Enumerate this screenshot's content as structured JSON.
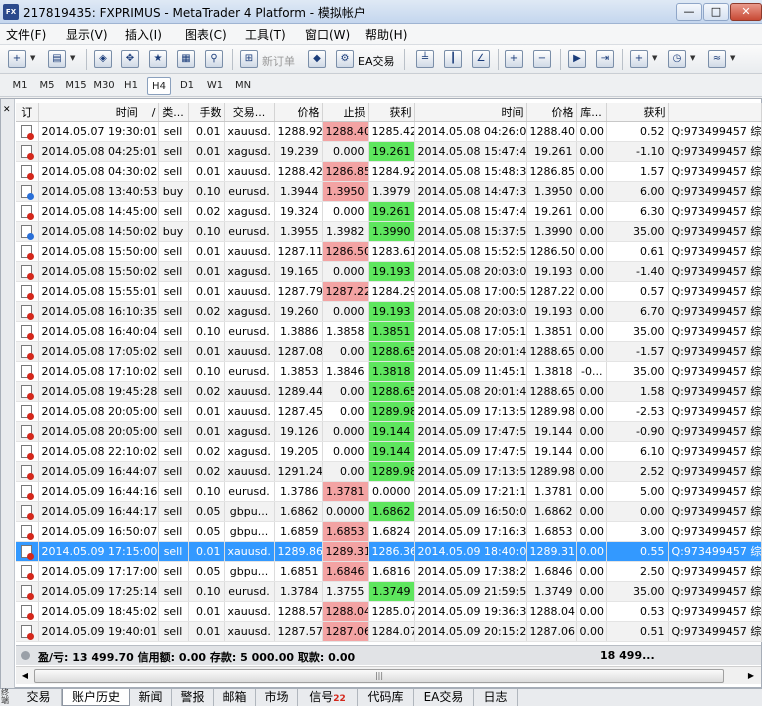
{
  "window": {
    "title": "217819435: FXPRIMUS - MetaTrader 4 Platform - 模拟帐户",
    "icon_label": "FX"
  },
  "menu": [
    "文件(F)",
    "显示(V)",
    "插入(I)",
    "图表(C)",
    "工具(T)",
    "窗口(W)",
    "帮助(H)"
  ],
  "toolbar": {
    "new_order": "新订单",
    "expert_advisors": "EA交易"
  },
  "timeframes": [
    "M1",
    "M5",
    "M15",
    "M30",
    "H1",
    "H4",
    "D1",
    "W1",
    "MN"
  ],
  "active_timeframe": "H4",
  "columns": [
    "订",
    "时间",
    "类...",
    "手数",
    "交易...",
    "价格",
    "止损",
    "获利",
    "时间",
    "价格",
    "库...",
    "获利",
    ""
  ],
  "sort_marker": "/",
  "colors": {
    "sl_hit": "#f3a3a3",
    "tp_hit": "#5ee65e",
    "selected": "#3399ff"
  },
  "rows": [
    {
      "open_time": "2014.05.07 19:30:01",
      "type": "sell",
      "lots": "0.01",
      "symbol": "xauusd.",
      "price": "1288.92",
      "sl": "1288.40",
      "tp": "1285.42",
      "close_time": "2014.05.08 04:26:08",
      "close_price": "1288.40",
      "swap": "0.00",
      "profit": "0.52",
      "comment": "Q:973499457 综合 ",
      "hit": "sl"
    },
    {
      "open_time": "2014.05.08 04:25:01",
      "type": "sell",
      "lots": "0.01",
      "symbol": "xagusd.",
      "price": "19.239",
      "sl": "0.000",
      "tp": "19.261",
      "close_time": "2014.05.08 15:47:40",
      "close_price": "19.261",
      "swap": "0.00",
      "profit": "-1.10",
      "comment": "Q:973499457 综合 ",
      "hit": "tp"
    },
    {
      "open_time": "2014.05.08 04:30:02",
      "type": "sell",
      "lots": "0.01",
      "symbol": "xauusd.",
      "price": "1288.42",
      "sl": "1286.85",
      "tp": "1284.92",
      "close_time": "2014.05.08 15:48:33",
      "close_price": "1286.85",
      "swap": "0.00",
      "profit": "1.57",
      "comment": "Q:973499457 综合 ",
      "hit": "sl"
    },
    {
      "open_time": "2014.05.08 13:40:53",
      "type": "buy",
      "lots": "0.10",
      "symbol": "eurusd.",
      "price": "1.3944",
      "sl": "1.3950",
      "tp": "1.3979",
      "close_time": "2014.05.08 14:47:38",
      "close_price": "1.3950",
      "swap": "0.00",
      "profit": "6.00",
      "comment": "Q:973499457 综合 ",
      "hit": "sl"
    },
    {
      "open_time": "2014.05.08 14:45:00",
      "type": "sell",
      "lots": "0.02",
      "symbol": "xagusd.",
      "price": "19.324",
      "sl": "0.000",
      "tp": "19.261",
      "close_time": "2014.05.08 15:47:40",
      "close_price": "19.261",
      "swap": "0.00",
      "profit": "6.30",
      "comment": "Q:973499457 综合 ",
      "hit": "tp"
    },
    {
      "open_time": "2014.05.08 14:50:02",
      "type": "buy",
      "lots": "0.10",
      "symbol": "eurusd.",
      "price": "1.3955",
      "sl": "1.3982",
      "tp": "1.3990",
      "close_time": "2014.05.08 15:37:54",
      "close_price": "1.3990",
      "swap": "0.00",
      "profit": "35.00",
      "comment": "Q:973499457 综合 ",
      "hit": "tp"
    },
    {
      "open_time": "2014.05.08 15:50:00",
      "type": "sell",
      "lots": "0.01",
      "symbol": "xauusd.",
      "price": "1287.11",
      "sl": "1286.50",
      "tp": "1283.61",
      "close_time": "2014.05.08 15:52:53",
      "close_price": "1286.50",
      "swap": "0.00",
      "profit": "0.61",
      "comment": "Q:973499457 综合 ",
      "hit": "sl"
    },
    {
      "open_time": "2014.05.08 15:50:02",
      "type": "sell",
      "lots": "0.01",
      "symbol": "xagusd.",
      "price": "19.165",
      "sl": "0.000",
      "tp": "19.193",
      "close_time": "2014.05.08 20:03:07",
      "close_price": "19.193",
      "swap": "0.00",
      "profit": "-1.40",
      "comment": "Q:973499457 综合 ",
      "hit": "tp"
    },
    {
      "open_time": "2014.05.08 15:55:01",
      "type": "sell",
      "lots": "0.01",
      "symbol": "xauusd.",
      "price": "1287.79",
      "sl": "1287.22",
      "tp": "1284.29",
      "close_time": "2014.05.08 17:00:57",
      "close_price": "1287.22",
      "swap": "0.00",
      "profit": "0.57",
      "comment": "Q:973499457 综合 ",
      "hit": "sl"
    },
    {
      "open_time": "2014.05.08 16:10:35",
      "type": "sell",
      "lots": "0.02",
      "symbol": "xagusd.",
      "price": "19.260",
      "sl": "0.000",
      "tp": "19.193",
      "close_time": "2014.05.08 20:03:07",
      "close_price": "19.193",
      "swap": "0.00",
      "profit": "6.70",
      "comment": "Q:973499457 综合 ",
      "hit": "tp"
    },
    {
      "open_time": "2014.05.08 16:40:04",
      "type": "sell",
      "lots": "0.10",
      "symbol": "eurusd.",
      "price": "1.3886",
      "sl": "1.3858",
      "tp": "1.3851",
      "close_time": "2014.05.08 17:05:15",
      "close_price": "1.3851",
      "swap": "0.00",
      "profit": "35.00",
      "comment": "Q:973499457 综合 ",
      "hit": "tp"
    },
    {
      "open_time": "2014.05.08 17:05:02",
      "type": "sell",
      "lots": "0.01",
      "symbol": "xauusd.",
      "price": "1287.08",
      "sl": "0.00",
      "tp": "1288.65",
      "close_time": "2014.05.08 20:01:44",
      "close_price": "1288.65",
      "swap": "0.00",
      "profit": "-1.57",
      "comment": "Q:973499457 综合 ",
      "hit": "tp"
    },
    {
      "open_time": "2014.05.08 17:10:02",
      "type": "sell",
      "lots": "0.10",
      "symbol": "eurusd.",
      "price": "1.3853",
      "sl": "1.3846",
      "tp": "1.3818",
      "close_time": "2014.05.09 11:45:12",
      "close_price": "1.3818",
      "swap": "-0...",
      "profit": "35.00",
      "comment": "Q:973499457 综合 ",
      "hit": "tp"
    },
    {
      "open_time": "2014.05.08 19:45:28",
      "type": "sell",
      "lots": "0.02",
      "symbol": "xauusd.",
      "price": "1289.44",
      "sl": "0.00",
      "tp": "1288.65",
      "close_time": "2014.05.08 20:01:44",
      "close_price": "1288.65",
      "swap": "0.00",
      "profit": "1.58",
      "comment": "Q:973499457 综合 ",
      "hit": "tp"
    },
    {
      "open_time": "2014.05.08 20:05:00",
      "type": "sell",
      "lots": "0.01",
      "symbol": "xauusd.",
      "price": "1287.45",
      "sl": "0.00",
      "tp": "1289.98",
      "close_time": "2014.05.09 17:13:59",
      "close_price": "1289.98",
      "swap": "0.00",
      "profit": "-2.53",
      "comment": "Q:973499457 综合 ",
      "hit": "tp"
    },
    {
      "open_time": "2014.05.08 20:05:00",
      "type": "sell",
      "lots": "0.01",
      "symbol": "xagusd.",
      "price": "19.126",
      "sl": "0.000",
      "tp": "19.144",
      "close_time": "2014.05.09 17:47:56",
      "close_price": "19.144",
      "swap": "0.00",
      "profit": "-0.90",
      "comment": "Q:973499457 综合 ",
      "hit": "tp"
    },
    {
      "open_time": "2014.05.08 22:10:02",
      "type": "sell",
      "lots": "0.02",
      "symbol": "xagusd.",
      "price": "19.205",
      "sl": "0.000",
      "tp": "19.144",
      "close_time": "2014.05.09 17:47:56",
      "close_price": "19.144",
      "swap": "0.00",
      "profit": "6.10",
      "comment": "Q:973499457 综合 ",
      "hit": "tp"
    },
    {
      "open_time": "2014.05.09 16:44:07",
      "type": "sell",
      "lots": "0.02",
      "symbol": "xauusd.",
      "price": "1291.24",
      "sl": "0.00",
      "tp": "1289.98",
      "close_time": "2014.05.09 17:13:59",
      "close_price": "1289.98",
      "swap": "0.00",
      "profit": "2.52",
      "comment": "Q:973499457 综合 ",
      "hit": "tp"
    },
    {
      "open_time": "2014.05.09 16:44:16",
      "type": "sell",
      "lots": "0.10",
      "symbol": "eurusd.",
      "price": "1.3786",
      "sl": "1.3781",
      "tp": "0.0000",
      "close_time": "2014.05.09 17:21:15",
      "close_price": "1.3781",
      "swap": "0.00",
      "profit": "5.00",
      "comment": "Q:973499457 综合 ",
      "hit": "sl"
    },
    {
      "open_time": "2014.05.09 16:44:17",
      "type": "sell",
      "lots": "0.05",
      "symbol": "gbpu...",
      "price": "1.6862",
      "sl": "0.0000",
      "tp": "1.6862",
      "close_time": "2014.05.09 16:50:06",
      "close_price": "1.6862",
      "swap": "0.00",
      "profit": "0.00",
      "comment": "Q:973499457 综合 ",
      "hit": "tp"
    },
    {
      "open_time": "2014.05.09 16:50:07",
      "type": "sell",
      "lots": "0.05",
      "symbol": "gbpu...",
      "price": "1.6859",
      "sl": "1.6853",
      "tp": "1.6824",
      "close_time": "2014.05.09 17:16:30",
      "close_price": "1.6853",
      "swap": "0.00",
      "profit": "3.00",
      "comment": "Q:973499457 综合 ",
      "hit": "sl"
    },
    {
      "open_time": "2014.05.09 17:15:00",
      "type": "sell",
      "lots": "0.01",
      "symbol": "xauusd.",
      "price": "1289.86",
      "sl": "1289.31",
      "tp": "1286.36",
      "close_time": "2014.05.09 18:40:01",
      "close_price": "1289.31",
      "swap": "0.00",
      "profit": "0.55",
      "comment": "Q:973499457 综合 ",
      "hit": "sl",
      "selected": true
    },
    {
      "open_time": "2014.05.09 17:17:00",
      "type": "sell",
      "lots": "0.05",
      "symbol": "gbpu...",
      "price": "1.6851",
      "sl": "1.6846",
      "tp": "1.6816",
      "close_time": "2014.05.09 17:38:25",
      "close_price": "1.6846",
      "swap": "0.00",
      "profit": "2.50",
      "comment": "Q:973499457 综合 ",
      "hit": "sl"
    },
    {
      "open_time": "2014.05.09 17:25:14",
      "type": "sell",
      "lots": "0.10",
      "symbol": "eurusd.",
      "price": "1.3784",
      "sl": "1.3755",
      "tp": "1.3749",
      "close_time": "2014.05.09 21:59:58",
      "close_price": "1.3749",
      "swap": "0.00",
      "profit": "35.00",
      "comment": "Q:973499457 综合 ",
      "hit": "tp"
    },
    {
      "open_time": "2014.05.09 18:45:02",
      "type": "sell",
      "lots": "0.01",
      "symbol": "xauusd.",
      "price": "1288.57",
      "sl": "1288.04",
      "tp": "1285.07",
      "close_time": "2014.05.09 19:36:31",
      "close_price": "1288.04",
      "swap": "0.00",
      "profit": "0.53",
      "comment": "Q:973499457 综合 ",
      "hit": "sl"
    },
    {
      "open_time": "2014.05.09 19:40:01",
      "type": "sell",
      "lots": "0.01",
      "symbol": "xauusd.",
      "price": "1287.57",
      "sl": "1287.06",
      "tp": "1284.07",
      "close_time": "2014.05.09 20:15:26",
      "close_price": "1287.06",
      "swap": "0.00",
      "profit": "0.51",
      "comment": "Q:973499457 综合 ",
      "hit": "sl"
    }
  ],
  "summary": {
    "text": "盈/亏: 13 499.70  信用额: 0.00  存款: 5 000.00  取款: 0.00",
    "total": "18 499..."
  },
  "side_label": "终端",
  "tabs": [
    "交易",
    "账户历史",
    "新闻",
    "警报",
    "邮箱",
    "市场",
    "信号",
    "代码库",
    "EA交易",
    "日志"
  ],
  "active_tab": "账户历史",
  "signal_badge": "22"
}
